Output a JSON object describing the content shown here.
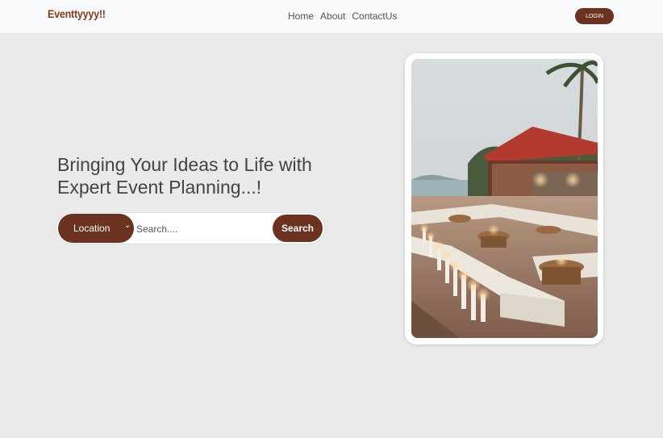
{
  "nav": {
    "brand": "Eventtyyyy!!",
    "links": [
      "Home",
      "About",
      "ContactUs"
    ],
    "login_label": "LOGIN"
  },
  "hero": {
    "headline": "Bringing Your Ideas to Life with Expert Event Planning...!",
    "search": {
      "location_label": "Location",
      "placeholder": "Search....",
      "button_label": "Search"
    },
    "image_alt": "Outdoor evening event lounge with candles by the sea"
  },
  "colors": {
    "brand": "#8a3b1e",
    "accent": "#6b3220",
    "background": "#eaeaea",
    "navbar": "#f8f9fa"
  },
  "icons": {
    "location_dropdown": "chevron-down-icon"
  }
}
